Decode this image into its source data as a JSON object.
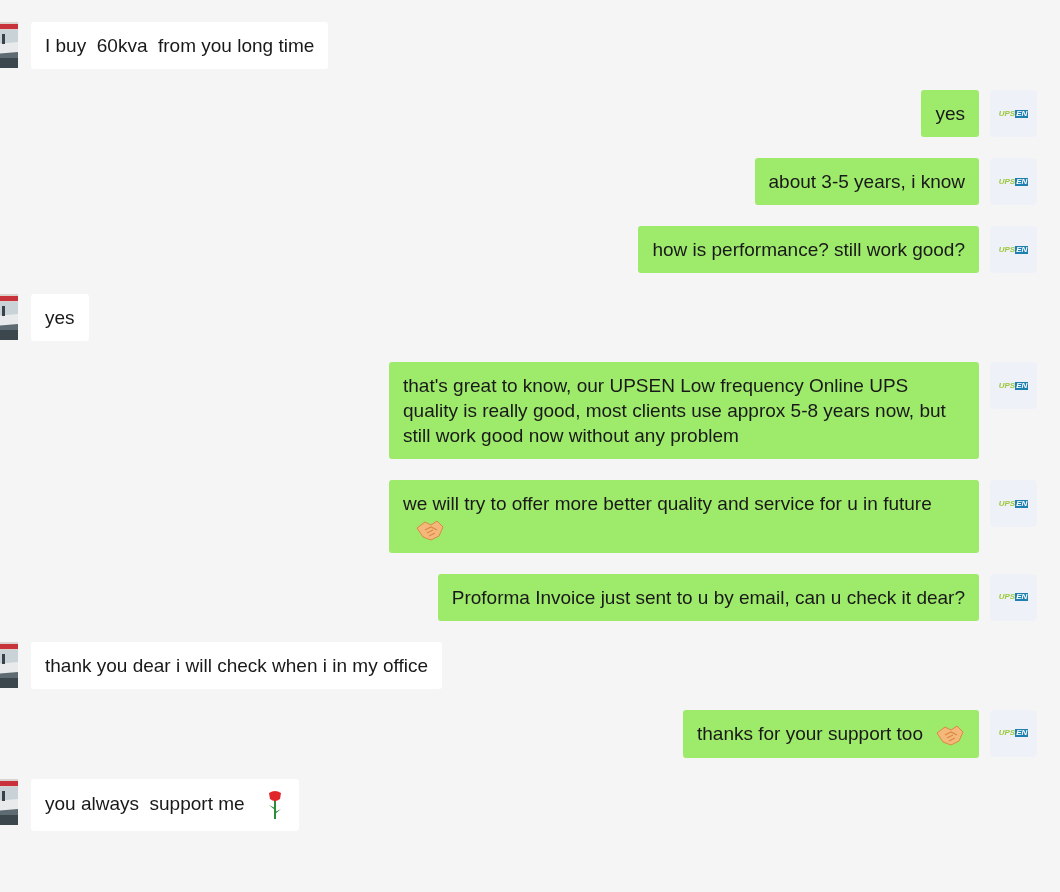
{
  "messages": [
    {
      "kind": "incoming",
      "text": "I buy  60kva  from you long time"
    },
    {
      "kind": "outgoing",
      "text": "yes",
      "avatar_logo": [
        "UPS",
        "EN"
      ]
    },
    {
      "kind": "outgoing",
      "text": "about 3-5 years, i know",
      "avatar_logo": [
        "UPS",
        "EN"
      ]
    },
    {
      "kind": "outgoing",
      "text": "how is performance? still work good?",
      "avatar_logo": [
        "UPS",
        "EN"
      ]
    },
    {
      "kind": "incoming",
      "text": "yes"
    },
    {
      "kind": "outgoing",
      "text": "that's great to know, our UPSEN Low frequency Online UPS quality is really good, most clients use approx 5-8 years now, but still work good now without any problem",
      "avatar_logo": [
        "UPS",
        "EN"
      ]
    },
    {
      "kind": "outgoing",
      "text": "we will try to offer more better quality and service for u in future",
      "attachment": {
        "kind": "handshake"
      },
      "avatar_logo": [
        "UPS",
        "EN"
      ]
    },
    {
      "kind": "outgoing",
      "text": "Proforma Invoice just sent to u by email, can u check it dear?",
      "avatar_logo": [
        "UPS",
        "EN"
      ]
    },
    {
      "kind": "incoming",
      "text": "thank you dear i will check when i in my office"
    },
    {
      "kind": "outgoing",
      "text": "thanks for your support too",
      "attachment": {
        "kind": "handshake"
      },
      "avatar_logo": [
        "UPS",
        "EN"
      ]
    },
    {
      "kind": "incoming",
      "text": "you always  support me",
      "attachment": {
        "kind": "rose"
      }
    }
  ]
}
